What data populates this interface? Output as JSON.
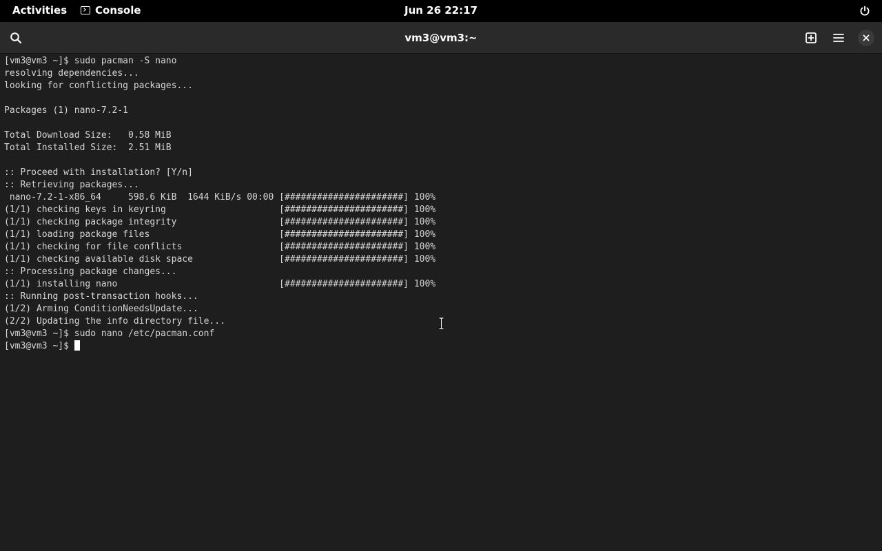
{
  "topbar": {
    "activities": "Activities",
    "app_name": "Console",
    "clock": "Jun 26  22:17"
  },
  "window": {
    "title": "vm3@vm3:~"
  },
  "terminal": {
    "lines": [
      "[vm3@vm3 ~]$ sudo pacman -S nano",
      "resolving dependencies...",
      "looking for conflicting packages...",
      "",
      "Packages (1) nano-7.2-1",
      "",
      "Total Download Size:   0.58 MiB",
      "Total Installed Size:  2.51 MiB",
      "",
      ":: Proceed with installation? [Y/n]",
      ":: Retrieving packages...",
      " nano-7.2-1-x86_64     598.6 KiB  1644 KiB/s 00:00 [######################] 100%",
      "(1/1) checking keys in keyring                     [######################] 100%",
      "(1/1) checking package integrity                   [######################] 100%",
      "(1/1) loading package files                        [######################] 100%",
      "(1/1) checking for file conflicts                  [######################] 100%",
      "(1/1) checking available disk space                [######################] 100%",
      ":: Processing package changes...",
      "(1/1) installing nano                              [######################] 100%",
      ":: Running post-transaction hooks...",
      "(1/2) Arming ConditionNeedsUpdate...",
      "(2/2) Updating the info directory file...",
      "[vm3@vm3 ~]$ sudo nano /etc/pacman.conf"
    ],
    "prompt": "[vm3@vm3 ~]$ "
  },
  "colors": {
    "topbar_bg": "#000000",
    "headerbar_bg": "#2a2a2a",
    "terminal_bg": "#1e1e1e",
    "terminal_fg": "#d6d6d6"
  },
  "icons": {
    "search": "search-icon",
    "new_tab": "new-tab-icon",
    "menu": "hamburger-menu-icon",
    "close": "close-icon",
    "power": "power-icon",
    "console": "console-icon",
    "pointer": "text-cursor-ibeam-icon"
  }
}
